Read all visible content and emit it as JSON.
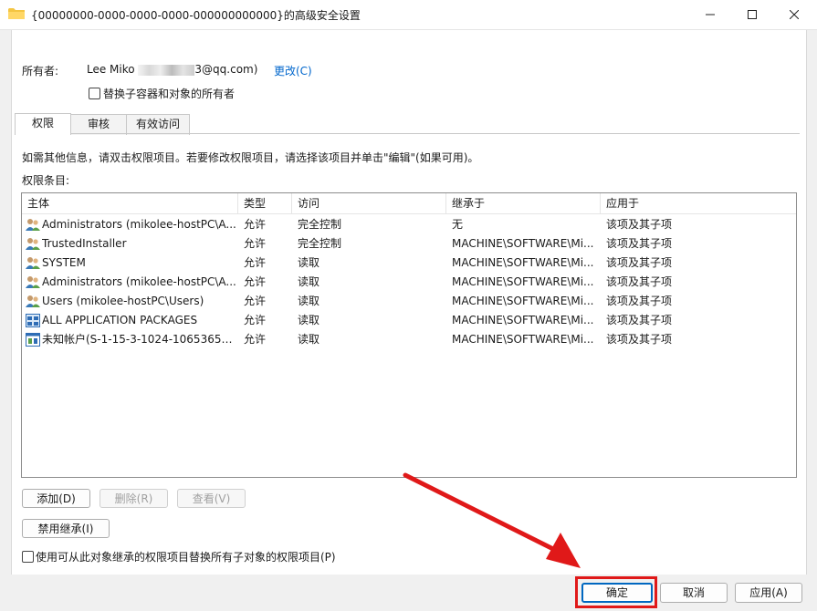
{
  "window": {
    "title": "{00000000-0000-0000-0000-000000000000}的高级安全设置",
    "icons": {
      "app": "folder-icon",
      "minimize": "minimize-icon",
      "maximize": "maximize-icon",
      "close": "close-icon"
    }
  },
  "owner": {
    "label": "所有者:",
    "name_prefix": "Lee Miko ",
    "name_suffix": "3@qq.com)",
    "change_link": "更改(C)",
    "replace_checkbox": "替换子容器和对象的所有者"
  },
  "tabs": [
    {
      "label": "权限",
      "active": true
    },
    {
      "label": "审核",
      "active": false
    },
    {
      "label": "有效访问",
      "active": false
    }
  ],
  "info_text": "如需其他信息，请双击权限项目。若要修改权限项目，请选择该项目并单击\"编辑\"(如果可用)。",
  "entries_label": "权限条目:",
  "columns": [
    "主体",
    "类型",
    "访问",
    "继承于",
    "应用于"
  ],
  "rows": [
    {
      "icon": "users-group-icon",
      "principal": "Administrators (mikolee-hostPC\\A...",
      "type": "允许",
      "access": "完全控制",
      "inherited": "无",
      "applies": "该项及其子项"
    },
    {
      "icon": "users-group-icon",
      "principal": "TrustedInstaller",
      "type": "允许",
      "access": "完全控制",
      "inherited": "MACHINE\\SOFTWARE\\Mi...",
      "applies": "该项及其子项"
    },
    {
      "icon": "users-group-icon",
      "principal": "SYSTEM",
      "type": "允许",
      "access": "读取",
      "inherited": "MACHINE\\SOFTWARE\\Mi...",
      "applies": "该项及其子项"
    },
    {
      "icon": "users-group-icon",
      "principal": "Administrators (mikolee-hostPC\\A...",
      "type": "允许",
      "access": "读取",
      "inherited": "MACHINE\\SOFTWARE\\Mi...",
      "applies": "该项及其子项"
    },
    {
      "icon": "users-group-icon",
      "principal": "Users (mikolee-hostPC\\Users)",
      "type": "允许",
      "access": "读取",
      "inherited": "MACHINE\\SOFTWARE\\Mi...",
      "applies": "该项及其子项"
    },
    {
      "icon": "app-packages-icon",
      "principal": "ALL APPLICATION PACKAGES",
      "type": "允许",
      "access": "读取",
      "inherited": "MACHINE\\SOFTWARE\\Mi...",
      "applies": "该项及其子项"
    },
    {
      "icon": "unknown-account-icon",
      "principal": "未知帐户(S-1-15-3-1024-106536593...",
      "type": "允许",
      "access": "读取",
      "inherited": "MACHINE\\SOFTWARE\\Mi...",
      "applies": "该项及其子项"
    }
  ],
  "buttons": {
    "add": "添加(D)",
    "remove": "删除(R)",
    "view": "查看(V)",
    "disable_inheritance": "禁用继承(I)",
    "ok": "确定",
    "cancel": "取消",
    "apply": "应用(A)"
  },
  "replace_child_checkbox": "使用可从此对象继承的权限项目替换所有子对象的权限项目(P)",
  "colors": {
    "link": "#0066cc",
    "annotation": "#e01919",
    "primary_border": "#0067c0"
  }
}
